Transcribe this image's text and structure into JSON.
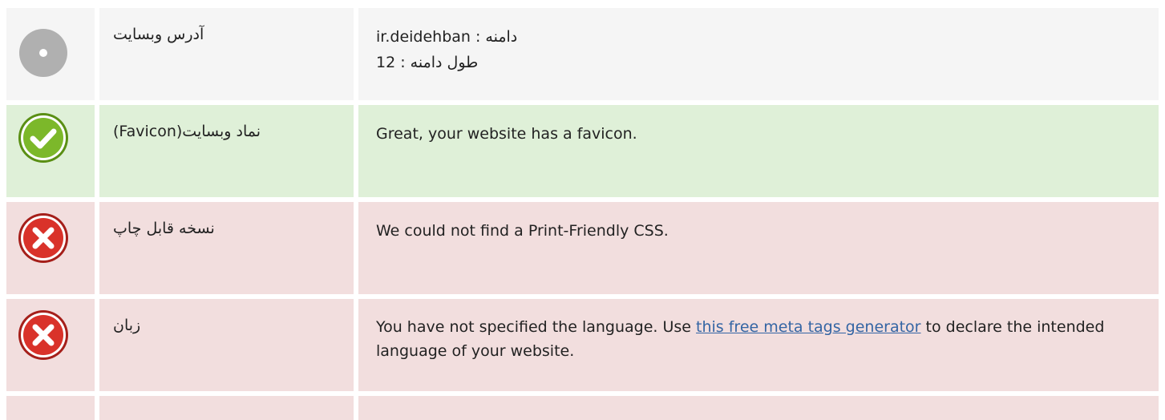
{
  "rows": [
    {
      "status": "neutral",
      "icon": "neutral-dot-icon",
      "label": "آدرس وبسایت",
      "lines": [
        "دامنه : ir.deidehban",
        "طول دامنه : 12"
      ]
    },
    {
      "status": "pass",
      "icon": "check-icon",
      "label": "نماد وبسایت(Favicon)",
      "text": "Great, your website has a favicon."
    },
    {
      "status": "fail",
      "icon": "cross-icon",
      "label": "نسخه قابل چاپ",
      "text": "We could not find a Print-Friendly CSS."
    },
    {
      "status": "fail",
      "icon": "cross-icon",
      "label": "زبان",
      "text_before": "You have not specified the language. Use ",
      "link": "this free meta tags generator",
      "text_after": " to declare the intended language of your website."
    },
    {
      "status": "fail"
    }
  ],
  "colors": {
    "neutral": "#f5f5f5",
    "pass": "#dff0d8",
    "fail": "#f2dede",
    "link": "#3465a4",
    "check_green": "#7cb82a",
    "cross_red": "#d9322a",
    "neutral_gray": "#b0b0b0"
  }
}
